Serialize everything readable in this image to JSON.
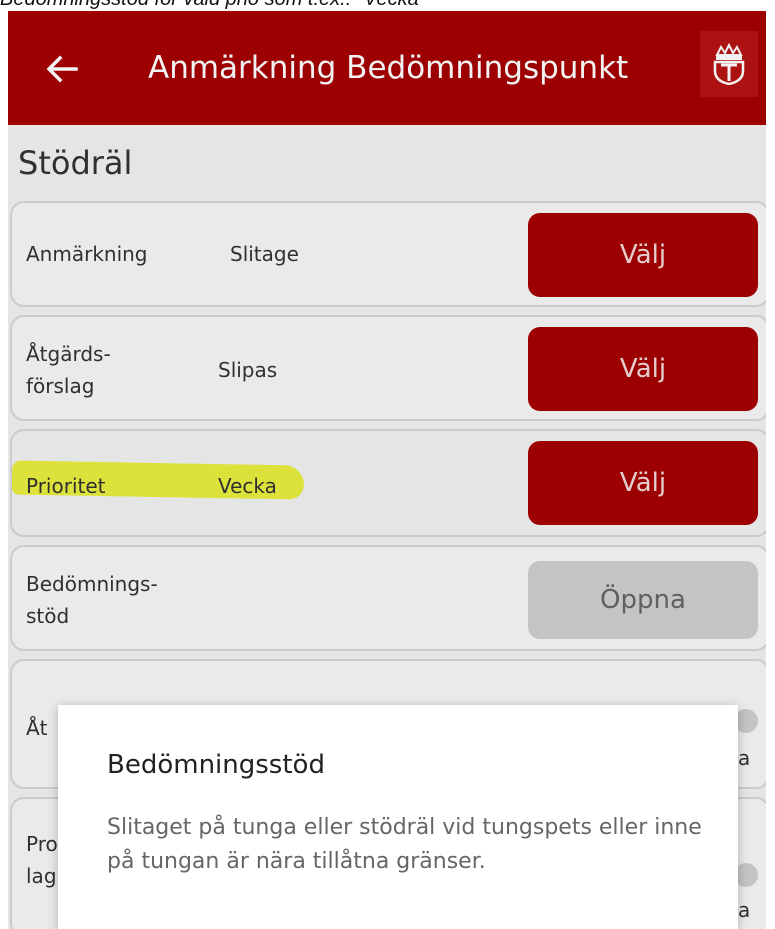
{
  "caption": "Bedömningsstöd för vald prio som t.ex.: \"Vecka\"",
  "appbar": {
    "title": "Anmärkning Bedömningspunkt",
    "back_icon": "arrow-left-icon",
    "logo_icon": "crown-shield-logo",
    "color": "#a50000"
  },
  "section_title": "Stödräl",
  "rows": [
    {
      "label": "Anmärkning",
      "value": "Slitage",
      "button": "Välj"
    },
    {
      "label_line1": "Åtgärds-",
      "label_line2": "förslag",
      "value": "Slipas",
      "button": "Välj"
    },
    {
      "label": "Prioritet",
      "value": "Vecka",
      "button": "Välj"
    },
    {
      "label_line1": "Bedömnings-",
      "label_line2": "stöd",
      "button": "Öppna"
    }
  ],
  "partial_rows": {
    "row5_label": "Åt",
    "row6_label_line1": "Pro",
    "row6_label_line2": "lag",
    "trailing_char": "a"
  },
  "dialog": {
    "title": "Bedömningsstöd",
    "body": "Slitaget på tunga eller stödräl vid tungspets eller inne på tungan är nära tillåtna gränser."
  }
}
